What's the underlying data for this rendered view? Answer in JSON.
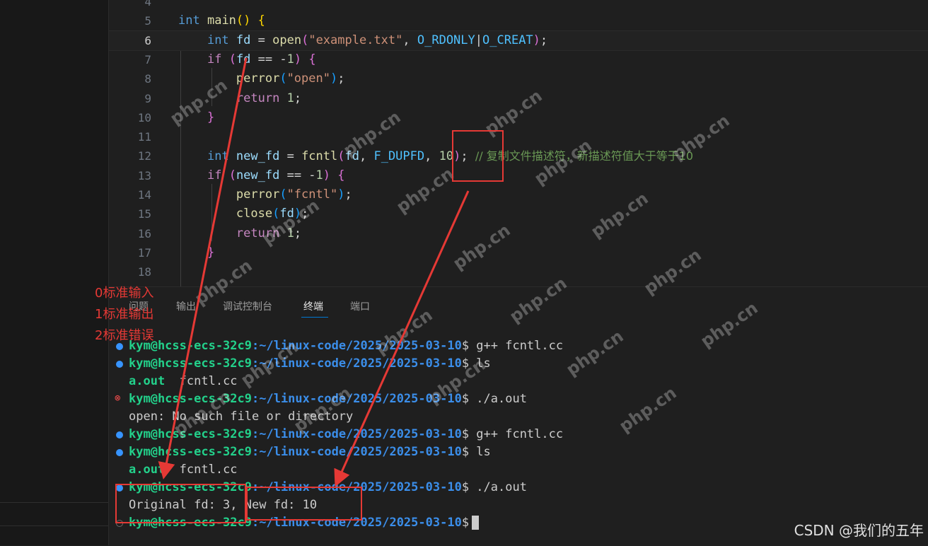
{
  "editor": {
    "lines": [
      {
        "num": "4",
        "html": ""
      },
      {
        "num": "5",
        "html": "<span class=\"kw\">int</span> <span class=\"fn\">main</span><span class=\"br1\">()</span> <span class=\"br1\">{</span>"
      },
      {
        "num": "6",
        "html": "    <span class=\"kw\">int</span> <span class=\"var\">fd</span> = <span class=\"fn\">open</span><span class=\"br2\">(</span><span class=\"str\">\"example.txt\"</span>, <span class=\"const\">O_RDONLY</span>|<span class=\"const\">O_CREAT</span><span class=\"br2\">)</span>;",
        "active": true
      },
      {
        "num": "7",
        "html": "    <span class=\"ctl\">if</span> <span class=\"br2\">(</span><span class=\"var\">fd</span> == -<span class=\"num\">1</span><span class=\"br2\">)</span> <span class=\"br2\">{</span>"
      },
      {
        "num": "8",
        "html": "        <span class=\"fn\">perror</span><span class=\"br3\">(</span><span class=\"str\">\"open\"</span><span class=\"br3\">)</span>;"
      },
      {
        "num": "9",
        "html": "        <span class=\"ctl\">return</span> <span class=\"num\">1</span>;"
      },
      {
        "num": "10",
        "html": "    <span class=\"br2\">}</span>"
      },
      {
        "num": "11",
        "html": ""
      },
      {
        "num": "12",
        "html": "    <span class=\"kw\">int</span> <span class=\"var\">new_fd</span> = <span class=\"fn\">fcntl</span><span class=\"br2\">(</span><span class=\"var\">fd</span>, <span class=\"const\">F_DUPFD</span>, <span class=\"num\">10</span><span class=\"br2\">)</span>; <span class=\"cmt\">// 复制文件描述符，新描述符值大于等于10</span>"
      },
      {
        "num": "13",
        "html": "    <span class=\"ctl\">if</span> <span class=\"br2\">(</span><span class=\"var\">new_fd</span> == -<span class=\"num\">1</span><span class=\"br2\">)</span> <span class=\"br2\">{</span>"
      },
      {
        "num": "14",
        "html": "        <span class=\"fn\">perror</span><span class=\"br3\">(</span><span class=\"str\">\"fcntl\"</span><span class=\"br3\">)</span>;"
      },
      {
        "num": "15",
        "html": "        <span class=\"fn\">close</span><span class=\"br3\">(</span><span class=\"var\">fd</span><span class=\"br3\">)</span>;"
      },
      {
        "num": "16",
        "html": "        <span class=\"ctl\">return</span> <span class=\"num\">1</span>;"
      },
      {
        "num": "17",
        "html": "    <span class=\"br2\">}</span>"
      },
      {
        "num": "18",
        "html": ""
      }
    ]
  },
  "panel": {
    "tabs": [
      "问题",
      "输出",
      "调试控制台",
      "终端",
      "端口"
    ],
    "active_tab": "终端",
    "terminal": [
      {
        "status": "ok",
        "user": "kym@hcss-ecs-32c9",
        "path": ":~/linux-code/2025/2025-03-10",
        "cmd": "$ g++ fcntl.cc"
      },
      {
        "status": "ok",
        "user": "kym@hcss-ecs-32c9",
        "path": ":~/linux-code/2025/2025-03-10",
        "cmd": "$ ls"
      },
      {
        "status": "",
        "green": "a.out",
        "text": "  fcntl.cc"
      },
      {
        "status": "err",
        "user": "kym@hcss-ecs-32c9",
        "path": ":~/linux-code/2025/2025-03-10",
        "cmd": "$ ./a.out"
      },
      {
        "status": "",
        "text": "open: No such file or directory"
      },
      {
        "status": "ok",
        "user": "kym@hcss-ecs-32c9",
        "path": ":~/linux-code/2025/2025-03-10",
        "cmd": "$ g++ fcntl.cc"
      },
      {
        "status": "ok",
        "user": "kym@hcss-ecs-32c9",
        "path": ":~/linux-code/2025/2025-03-10",
        "cmd": "$ ls"
      },
      {
        "status": "",
        "green": "a.out",
        "text": "  fcntl.cc"
      },
      {
        "status": "ok",
        "user": "kym@hcss-ecs-32c9",
        "path": ":~/linux-code/2025/2025-03-10",
        "cmd": "$ ./a.out"
      },
      {
        "status": "",
        "text": "Original fd: 3, New fd: 10"
      },
      {
        "status": "none",
        "user": "kym@hcss-ecs-32c9",
        "path": ":~/linux-code/2025/2025-03-10",
        "cmd": "$",
        "cursor": true
      }
    ]
  },
  "annotations": {
    "std_labels": [
      "0标准输入",
      "1标准输出",
      "2标准错误"
    ],
    "red": "#e53935"
  },
  "watermark": "CSDN @我们的五年",
  "php_watermark": "php.cn"
}
